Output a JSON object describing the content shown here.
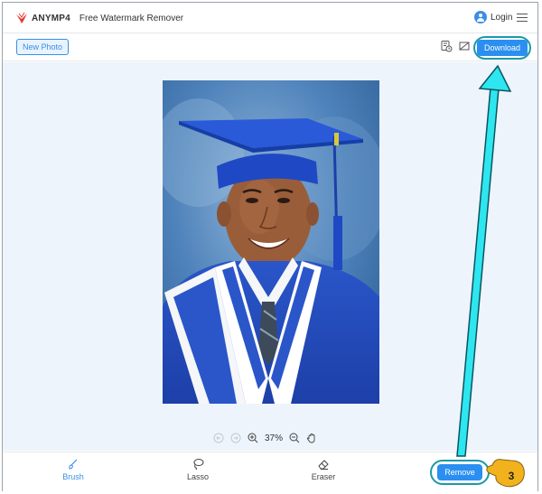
{
  "header": {
    "brand": "ANYMP4",
    "app_title": "Free Watermark Remover",
    "login_label": "Login"
  },
  "toolbar": {
    "new_photo_label": "New Photo",
    "download_label": "Download"
  },
  "canvas": {
    "zoom_level": "37%"
  },
  "tools": {
    "brush_label": "Brush",
    "lasso_label": "Lasso",
    "eraser_label": "Eraser",
    "remove_label": "Remove"
  },
  "annotation": {
    "step_number": "3"
  },
  "colors": {
    "accent": "#2a8ff0",
    "highlight_ring": "#1a9aa8",
    "arrow": "#2ee6f0",
    "pointer_hand": "#f2b21e"
  }
}
